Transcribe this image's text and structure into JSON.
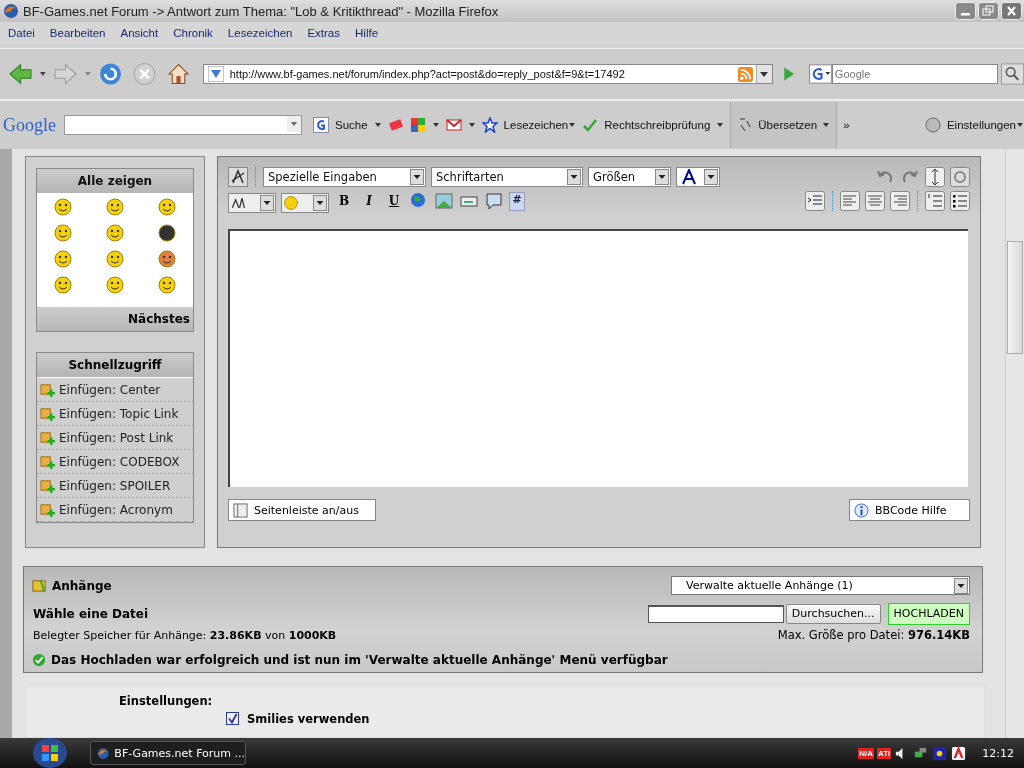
{
  "window": {
    "title": "BF-Games.net Forum -> Antwort zum Thema: \"Lob & Kritikthread\" - Mozilla Firefox"
  },
  "menu": [
    "Datei",
    "Bearbeiten",
    "Ansicht",
    "Chronik",
    "Lesezeichen",
    "Extras",
    "Hilfe"
  ],
  "navigation": {
    "url": "http://www.bf-games.net/forum/index.php?act=post&do=reply_post&f=9&t=17492",
    "search_placeholder": "Google"
  },
  "google_toolbar": {
    "logo": "Google",
    "search_button": "Suche",
    "bookmarks": "Lesezeichen",
    "spellcheck": "Rechtschreibprüfung",
    "translate": "Übersetzen",
    "more": "»",
    "settings": "Einstellungen"
  },
  "smilies": {
    "title": "Alle zeigen",
    "next": "Nächstes"
  },
  "quick_access": {
    "title": "Schnellzugriff",
    "items": [
      "Einfügen: Center",
      "Einfügen: Topic Link",
      "Einfügen: Post Link",
      "Einfügen: CODEBOX",
      "Einfügen: SPOILER",
      "Einfügen: Acronym"
    ]
  },
  "editor": {
    "selects": [
      "Spezielle Eingaben",
      "Schriftarten",
      "Größen"
    ],
    "text_buttons": [
      "B",
      "I",
      "U"
    ],
    "code_button": "#",
    "sidebar_toggle": "Seitenleiste an/aus",
    "help": "BBCode Hilfe"
  },
  "attachments": {
    "title": "Anhänge",
    "manage_select": "Verwalte aktuelle Anhänge (1)",
    "choose_label": "Wähle eine Datei",
    "browse": "Durchsuchen...",
    "upload": "HOCHLADEN",
    "usage": "Belegter Speicher für Anhänge: **23.86KB** von **1000KB**",
    "max_size": "Max. Größe pro Datei: **976.14KB**",
    "success": "Das Hochladen war erfolgreich und ist nun im 'Verwalte aktuelle Anhänge' Menü verfügbar"
  },
  "settings": {
    "label": "Einstellungen:",
    "options": [
      {
        "label": "Smilies verwenden",
        "checked": true
      }
    ]
  },
  "taskbar": {
    "task": "BF-Games.net Forum ...",
    "tray": [
      "N/A",
      "ATI"
    ],
    "clock": "12:12"
  }
}
